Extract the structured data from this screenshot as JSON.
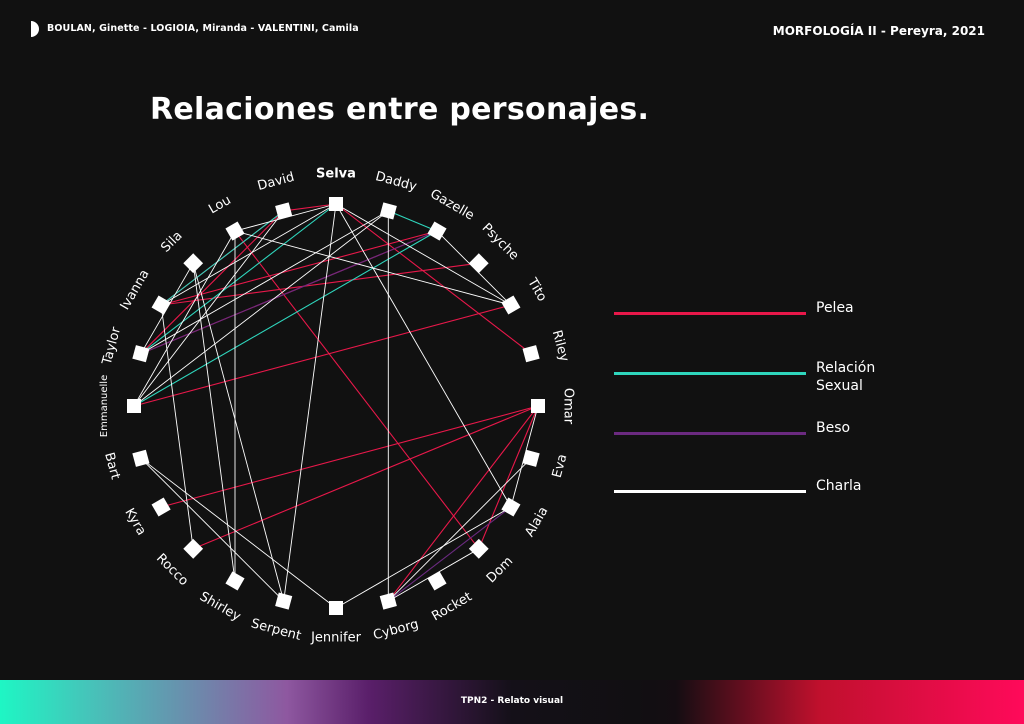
{
  "header": {
    "authors": "BOULAN, Ginette - LOGIOIA, Miranda - VALENTINI, Camila",
    "course": "MORFOLOGÍA II - Pereyra, 2021"
  },
  "title": "Relaciones entre personajes.",
  "colors": {
    "background": "#111111",
    "pelea": "#e8184a",
    "relacion_sexual": "#2fd6bd",
    "beso": "#6b2a80",
    "charla": "#ffffff"
  },
  "legend": [
    {
      "key": "pelea",
      "label": "Pelea"
    },
    {
      "key": "relacion_sexual",
      "label": "Relación\nSexual"
    },
    {
      "key": "beso",
      "label": "Beso"
    },
    {
      "key": "charla",
      "label": "Charla"
    }
  ],
  "nodes": [
    {
      "id": "selva",
      "label": "Selva",
      "bold": true
    },
    {
      "id": "daddy",
      "label": "Daddy"
    },
    {
      "id": "gazelle",
      "label": "Gazelle"
    },
    {
      "id": "psyche",
      "label": "Psyche"
    },
    {
      "id": "tito",
      "label": "Tito"
    },
    {
      "id": "riley",
      "label": "Riley"
    },
    {
      "id": "omar",
      "label": "Omar"
    },
    {
      "id": "eva",
      "label": "Eva"
    },
    {
      "id": "alaia",
      "label": "Alaia"
    },
    {
      "id": "dom",
      "label": "Dom"
    },
    {
      "id": "rocket",
      "label": "Rocket"
    },
    {
      "id": "cyborg",
      "label": "Cyborg"
    },
    {
      "id": "jennifer",
      "label": "Jennifer"
    },
    {
      "id": "serpent",
      "label": "Serpent"
    },
    {
      "id": "shirley",
      "label": "Shirley"
    },
    {
      "id": "rocco",
      "label": "Rocco"
    },
    {
      "id": "kyra",
      "label": "Kyra"
    },
    {
      "id": "bart",
      "label": "Bart"
    },
    {
      "id": "emmanuelle",
      "label": "Emmanuelle",
      "small": true
    },
    {
      "id": "taylor",
      "label": "Taylor"
    },
    {
      "id": "ivanna",
      "label": "Ivanna"
    },
    {
      "id": "sila",
      "label": "Sila"
    },
    {
      "id": "lou",
      "label": "Lou"
    },
    {
      "id": "david",
      "label": "David"
    }
  ],
  "edges": [
    {
      "a": "david",
      "b": "taylor",
      "type": "pelea"
    },
    {
      "a": "david",
      "b": "ivanna",
      "type": "pelea"
    },
    {
      "a": "lou",
      "b": "dom",
      "type": "pelea"
    },
    {
      "a": "selva",
      "b": "david",
      "type": "pelea"
    },
    {
      "a": "selva",
      "b": "riley",
      "type": "pelea"
    },
    {
      "a": "gazelle",
      "b": "taylor",
      "type": "pelea"
    },
    {
      "a": "gazelle",
      "b": "ivanna",
      "type": "pelea"
    },
    {
      "a": "psyche",
      "b": "ivanna",
      "type": "pelea"
    },
    {
      "a": "tito",
      "b": "emmanuelle",
      "type": "pelea"
    },
    {
      "a": "omar",
      "b": "kyra",
      "type": "pelea"
    },
    {
      "a": "omar",
      "b": "rocco",
      "type": "pelea"
    },
    {
      "a": "omar",
      "b": "cyborg",
      "type": "pelea"
    },
    {
      "a": "omar",
      "b": "dom",
      "type": "pelea"
    },
    {
      "a": "selva",
      "b": "taylor",
      "type": "relacion_sexual"
    },
    {
      "a": "david",
      "b": "ivanna",
      "type": "relacion_sexual"
    },
    {
      "a": "daddy",
      "b": "gazelle",
      "type": "relacion_sexual"
    },
    {
      "a": "gazelle",
      "b": "emmanuelle",
      "type": "relacion_sexual"
    },
    {
      "a": "gazelle",
      "b": "taylor",
      "type": "beso"
    },
    {
      "a": "alaia",
      "b": "cyborg",
      "type": "beso"
    },
    {
      "a": "lou",
      "b": "selva",
      "type": "charla"
    },
    {
      "a": "lou",
      "b": "tito",
      "type": "charla"
    },
    {
      "a": "lou",
      "b": "emmanuelle",
      "type": "charla"
    },
    {
      "a": "lou",
      "b": "shirley",
      "type": "charla"
    },
    {
      "a": "david",
      "b": "emmanuelle",
      "type": "charla"
    },
    {
      "a": "selva",
      "b": "ivanna",
      "type": "charla"
    },
    {
      "a": "selva",
      "b": "tito",
      "type": "charla"
    },
    {
      "a": "selva",
      "b": "alaia",
      "type": "charla"
    },
    {
      "a": "selva",
      "b": "serpent",
      "type": "charla"
    },
    {
      "a": "daddy",
      "b": "taylor",
      "type": "charla"
    },
    {
      "a": "daddy",
      "b": "emmanuelle",
      "type": "charla"
    },
    {
      "a": "daddy",
      "b": "cyborg",
      "type": "charla"
    },
    {
      "a": "gazelle",
      "b": "tito",
      "type": "charla"
    },
    {
      "a": "sila",
      "b": "shirley",
      "type": "charla"
    },
    {
      "a": "sila",
      "b": "serpent",
      "type": "charla"
    },
    {
      "a": "sila",
      "b": "taylor",
      "type": "charla"
    },
    {
      "a": "ivanna",
      "b": "rocco",
      "type": "charla"
    },
    {
      "a": "bart",
      "b": "serpent",
      "type": "charla"
    },
    {
      "a": "bart",
      "b": "jennifer",
      "type": "charla"
    },
    {
      "a": "omar",
      "b": "alaia",
      "type": "charla"
    },
    {
      "a": "eva",
      "b": "cyborg",
      "type": "charla"
    },
    {
      "a": "alaia",
      "b": "jennifer",
      "type": "charla"
    },
    {
      "a": "dom",
      "b": "cyborg",
      "type": "charla"
    }
  ],
  "footer": {
    "text": "TPN2 - Relato visual"
  }
}
